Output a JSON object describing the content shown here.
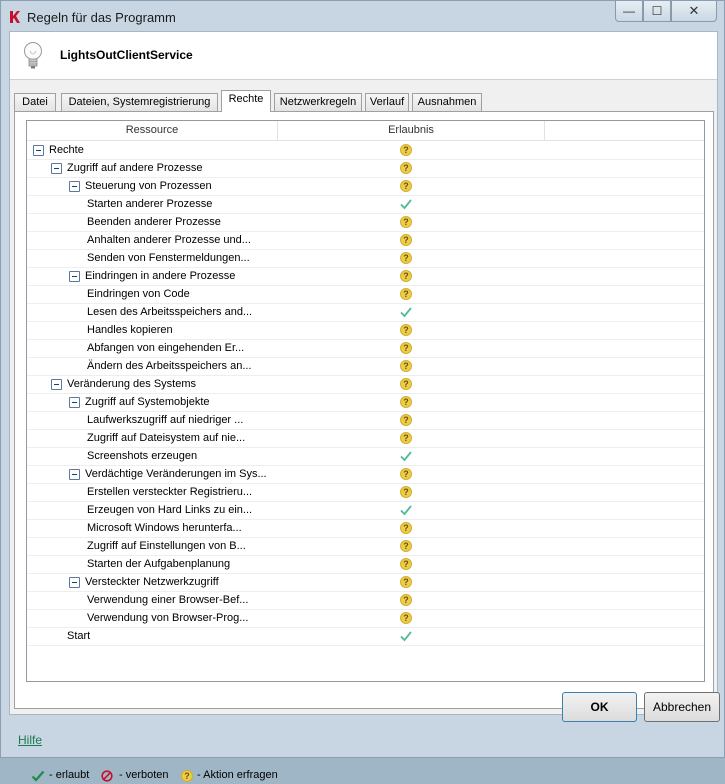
{
  "window": {
    "title": "Regeln für das Programm",
    "min_glyph": "—",
    "max_glyph": "☐",
    "close_glyph": "✕"
  },
  "program": {
    "name": "LightsOutClientService"
  },
  "tabs": [
    {
      "label": "Datei",
      "active": false
    },
    {
      "label": "Dateien, Systemregistrierung",
      "active": false
    },
    {
      "label": "Rechte",
      "active": true
    },
    {
      "label": "Netzwerkregeln",
      "active": false
    },
    {
      "label": "Verlauf",
      "active": false
    },
    {
      "label": "Ausnahmen",
      "active": false
    }
  ],
  "columns": {
    "resource": "Ressource",
    "permission": "Erlaubnis"
  },
  "rows": [
    {
      "level": 0,
      "expander": true,
      "label": "Rechte",
      "permission": "ask"
    },
    {
      "level": 1,
      "expander": true,
      "label": "Zugriff auf andere Prozesse",
      "permission": "ask"
    },
    {
      "level": 2,
      "expander": true,
      "label": "Steuerung von Prozessen",
      "permission": "ask"
    },
    {
      "level": 3,
      "expander": false,
      "label": "Starten anderer Prozesse",
      "permission": "allow"
    },
    {
      "level": 3,
      "expander": false,
      "label": "Beenden anderer Prozesse",
      "permission": "ask"
    },
    {
      "level": 3,
      "expander": false,
      "label": "Anhalten anderer Prozesse und...",
      "permission": "ask"
    },
    {
      "level": 3,
      "expander": false,
      "label": "Senden von Fenstermeldungen...",
      "permission": "ask"
    },
    {
      "level": 2,
      "expander": true,
      "label": "Eindringen in andere Prozesse",
      "permission": "ask"
    },
    {
      "level": 3,
      "expander": false,
      "label": "Eindringen von Code",
      "permission": "ask"
    },
    {
      "level": 3,
      "expander": false,
      "label": "Lesen des Arbeitsspeichers and...",
      "permission": "allow"
    },
    {
      "level": 3,
      "expander": false,
      "label": "Handles kopieren",
      "permission": "ask"
    },
    {
      "level": 3,
      "expander": false,
      "label": "Abfangen von eingehenden Er...",
      "permission": "ask"
    },
    {
      "level": 3,
      "expander": false,
      "label": "Ändern des Arbeitsspeichers an...",
      "permission": "ask"
    },
    {
      "level": 1,
      "expander": true,
      "label": "Veränderung des Systems",
      "permission": "ask"
    },
    {
      "level": 2,
      "expander": true,
      "label": "Zugriff auf Systemobjekte",
      "permission": "ask"
    },
    {
      "level": 3,
      "expander": false,
      "label": "Laufwerkszugriff auf niedriger ...",
      "permission": "ask"
    },
    {
      "level": 3,
      "expander": false,
      "label": "Zugriff auf Dateisystem auf nie...",
      "permission": "ask"
    },
    {
      "level": 3,
      "expander": false,
      "label": "Screenshots erzeugen",
      "permission": "allow"
    },
    {
      "level": 2,
      "expander": true,
      "label": "Verdächtige Veränderungen im Sys...",
      "permission": "ask"
    },
    {
      "level": 3,
      "expander": false,
      "label": "Erstellen versteckter Registrieru...",
      "permission": "ask"
    },
    {
      "level": 3,
      "expander": false,
      "label": "Erzeugen von Hard Links zu ein...",
      "permission": "allow"
    },
    {
      "level": 3,
      "expander": false,
      "label": "Microsoft Windows herunterfa...",
      "permission": "ask"
    },
    {
      "level": 3,
      "expander": false,
      "label": "Zugriff auf Einstellungen von B...",
      "permission": "ask"
    },
    {
      "level": 3,
      "expander": false,
      "label": "Starten der Aufgabenplanung",
      "permission": "ask"
    },
    {
      "level": 2,
      "expander": true,
      "label": "Versteckter Netzwerkzugriff",
      "permission": "ask"
    },
    {
      "level": 3,
      "expander": false,
      "label": "Verwendung einer Browser-Bef...",
      "permission": "ask"
    },
    {
      "level": 3,
      "expander": false,
      "label": "Verwendung von Browser-Prog...",
      "permission": "ask"
    },
    {
      "level": 1,
      "expander": false,
      "label": "Start",
      "permission": "allow"
    }
  ],
  "legend": {
    "allowed": "- erlaubt",
    "forbidden": "- verboten",
    "ask": "- Aktion erfragen"
  },
  "icons": {
    "allow": "check-icon",
    "ask": "question-icon",
    "forbid": "forbidden-icon"
  },
  "colors": {
    "allow": "#4dbb9c",
    "ask": "#eccd4a",
    "forbid": "#c8102e",
    "link": "#1f7a55"
  },
  "footer": {
    "help": "Hilfe",
    "ok": "OK",
    "cancel": "Abbrechen"
  }
}
